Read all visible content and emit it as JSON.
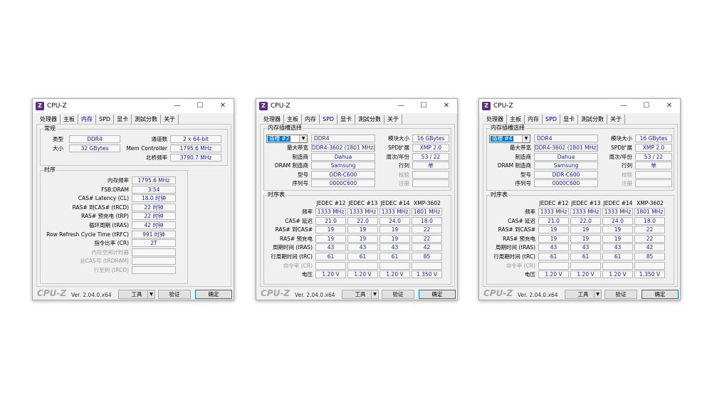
{
  "app": {
    "title": "CPU-Z",
    "logo": "Z",
    "minimize": "—",
    "maximize": "☐",
    "close": "✕"
  },
  "tabs": [
    "处理器",
    "主板",
    "内存",
    "SPD",
    "显卡",
    "測試分數",
    "关于"
  ],
  "footer": {
    "brand": "CPU-Z",
    "version": "Ver. 2.04.0.x64",
    "tools": "工具",
    "tools_arrow": "▼",
    "validate": "验证",
    "ok": "确定"
  },
  "memory": {
    "general_title": "常规",
    "type_label": "类型",
    "type": "DDR4",
    "size_label": "大小",
    "size": "32 GBytes",
    "channels_label": "通道数",
    "channels": "2 x 64-bit",
    "memctrl_label": "Mem Controller",
    "memctrl": "1795.6 MHz",
    "nb_label": "北桥频率",
    "nb": "3790.7 MHz",
    "timings_title": "时序",
    "timings": [
      {
        "label": "内存频率",
        "value": "1795.6 MHz",
        "disabled": false
      },
      {
        "label": "FSB:DRAM",
        "value": "3:54",
        "disabled": false
      },
      {
        "label": "CAS# Latency (CL)",
        "value": "18.0 时钟",
        "disabled": false
      },
      {
        "label": "RAS# 到CAS# (tRCD)",
        "value": "22 时钟",
        "disabled": false
      },
      {
        "label": "RAS# 预充电 (tRP)",
        "value": "22 时钟",
        "disabled": false
      },
      {
        "label": "循环周期 (tRAS)",
        "value": "42 时钟",
        "disabled": false
      },
      {
        "label": "Row Refresh Cycle Time (tRFC)",
        "value": "991 时钟",
        "disabled": false
      },
      {
        "label": "指令比率 (CR)",
        "value": "2T",
        "disabled": false
      },
      {
        "label": "内存空闲计时器",
        "value": "",
        "disabled": true
      },
      {
        "label": "总CAS号 (tRDRAM)",
        "value": "",
        "disabled": true
      },
      {
        "label": "行至列 (tRCD)",
        "value": "",
        "disabled": true
      }
    ]
  },
  "spd_labels": {
    "slot_title": "内存插槽选择",
    "module_size": "模块大小",
    "max_bw": "最大带宽",
    "spd_ext": "SPD扩展",
    "manufacturer": "制造商",
    "week_year": "周次/年份",
    "dram_mfr": "DRAM 制造商",
    "ranks": "行列",
    "part": "型号",
    "check": "校验",
    "serial": "序列号",
    "reg": "注册",
    "timing_title": "时序表",
    "rows": [
      "频率",
      "CAS# 延迟",
      "RAS# 到CAS#",
      "RAS# 预充电",
      "周期时间 (tRAS)",
      "行周期时间 (tRC)",
      "命令率 (CR)",
      "电压"
    ]
  },
  "spd": [
    {
      "slot": "插槽 #2",
      "type": "DDR4",
      "module_size": "16 GBytes",
      "max_bw": "DDR4-3602 (1801 MHz)",
      "spd_ext": "XMP 2.0",
      "manufacturer": "Dahua",
      "week_year": "53 / 22",
      "dram_mfr": "Samsung",
      "ranks": "单",
      "part": "DDR-C600",
      "serial": "0000C600",
      "cols": [
        "JEDEC #12",
        "JEDEC #13",
        "JEDEC #14",
        "XMP-3602"
      ],
      "table": [
        [
          "1333 MHz",
          "1333 MHz",
          "1333 MHz",
          "1801 MHz"
        ],
        [
          "21.0",
          "22.0",
          "24.0",
          "18.0"
        ],
        [
          "19",
          "19",
          "19",
          "22"
        ],
        [
          "19",
          "19",
          "19",
          "22"
        ],
        [
          "43",
          "43",
          "43",
          "42"
        ],
        [
          "61",
          "61",
          "61",
          "85"
        ],
        [
          "",
          "",
          "",
          ""
        ],
        [
          "1.20 V",
          "1.20 V",
          "1.20 V",
          "1.350 V"
        ]
      ]
    },
    {
      "slot": "插槽 #4",
      "type": "DDR4",
      "module_size": "16 GBytes",
      "max_bw": "DDR4-3602 (1801 MHz)",
      "spd_ext": "XMP 2.0",
      "manufacturer": "Dahua",
      "week_year": "53 / 22",
      "dram_mfr": "Samsung",
      "ranks": "单",
      "part": "DDR-C600",
      "serial": "0000C600",
      "cols": [
        "JEDEC #12",
        "JEDEC #13",
        "JEDEC #14",
        "XMP-3602"
      ],
      "table": [
        [
          "1333 MHz",
          "1333 MHz",
          "1333 MHz",
          "1801 MHz"
        ],
        [
          "21.0",
          "22.0",
          "24.0",
          "18.0"
        ],
        [
          "19",
          "19",
          "19",
          "22"
        ],
        [
          "19",
          "19",
          "19",
          "22"
        ],
        [
          "43",
          "43",
          "43",
          "42"
        ],
        [
          "61",
          "61",
          "61",
          "85"
        ],
        [
          "",
          "",
          "",
          ""
        ],
        [
          "1.20 V",
          "1.20 V",
          "1.20 V",
          "1.350 V"
        ]
      ]
    }
  ]
}
